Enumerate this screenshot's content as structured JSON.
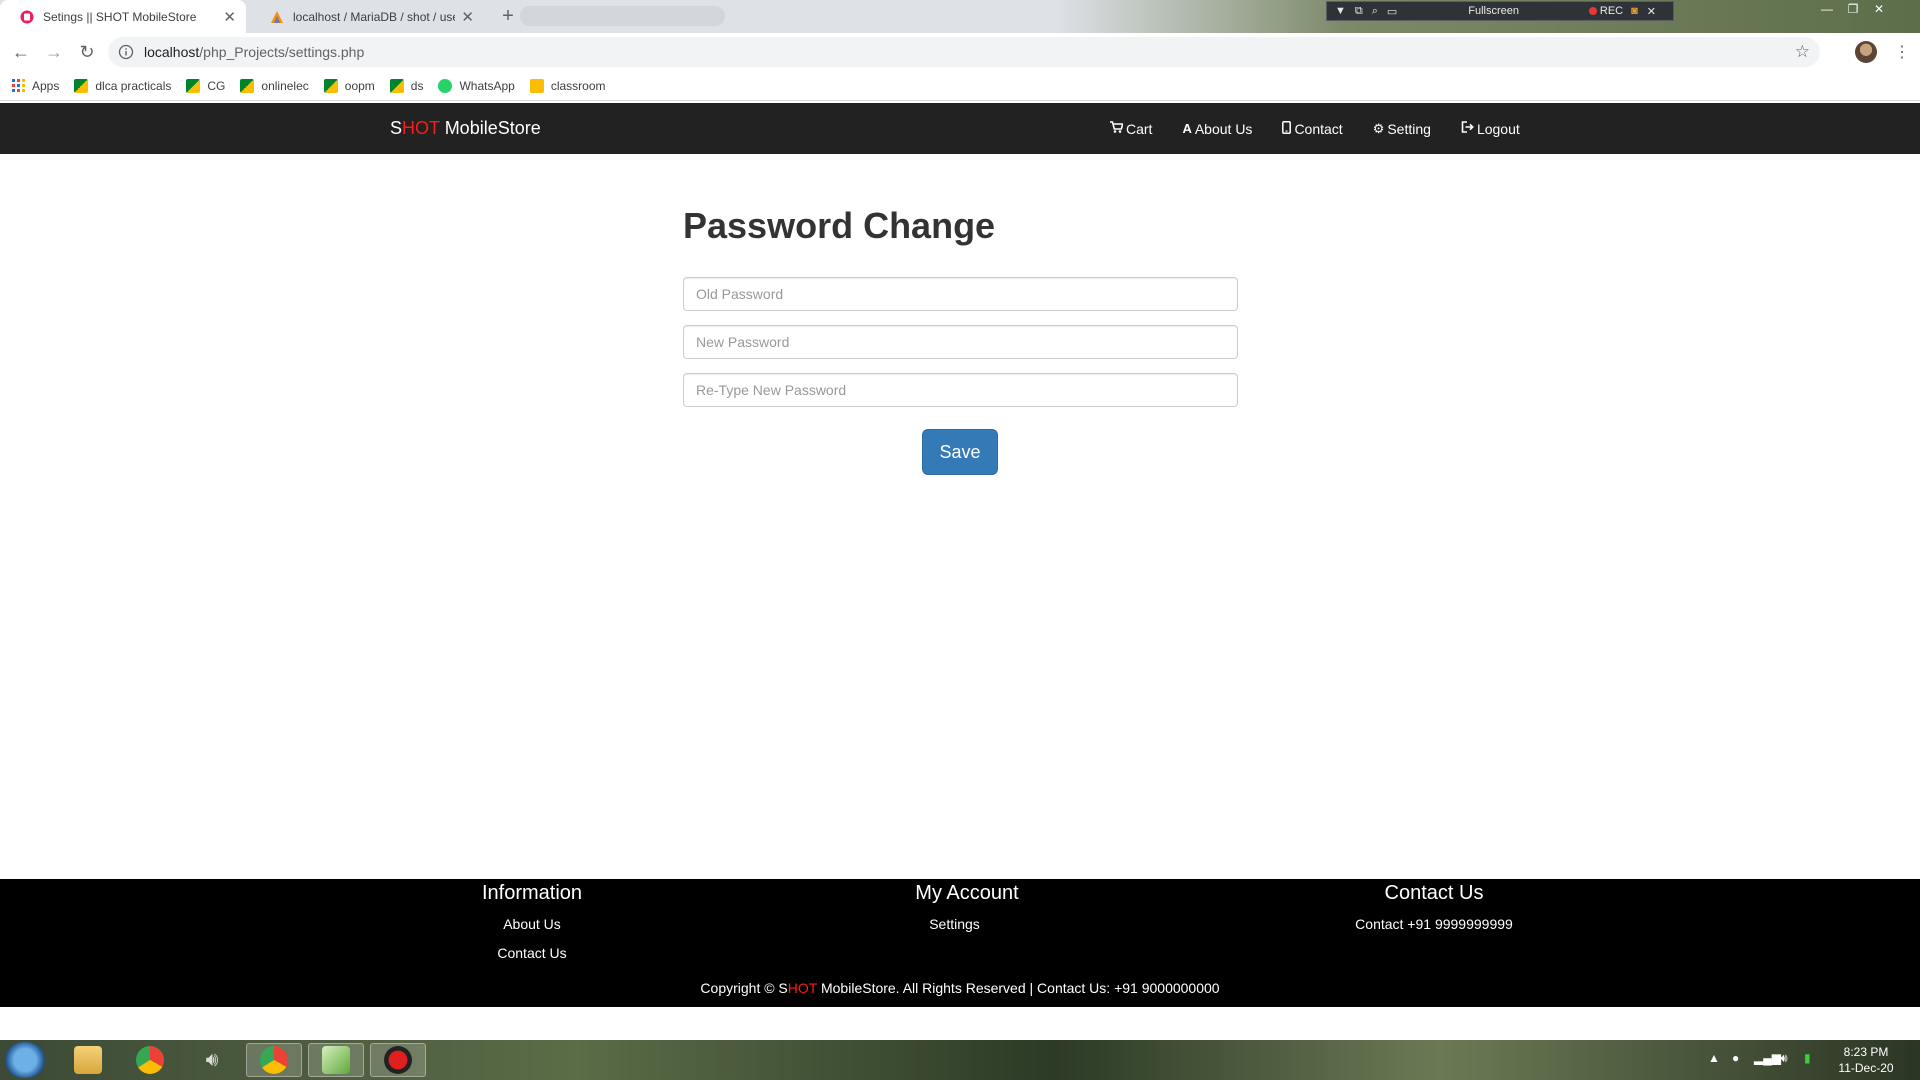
{
  "browser": {
    "tabs": [
      {
        "title": "Setings || SHOT MobileStore",
        "active": true
      },
      {
        "title": "localhost / MariaDB / shot / user",
        "active": false
      }
    ],
    "address": {
      "host": "localhost",
      "path": "/php_Projects/settings.php"
    },
    "bookmarks": [
      "Apps",
      "dlca practicals",
      "CG",
      "onlinelec",
      "oopm",
      "ds",
      "WhatsApp",
      "classroom"
    ],
    "recorder": {
      "mode": "Fullscreen",
      "rec_label": "REC"
    }
  },
  "site": {
    "brand": {
      "prefix": "S",
      "highlight": "HOT",
      "suffix": " MobileStore"
    },
    "nav": [
      {
        "label": "Cart",
        "icon": "cart-icon"
      },
      {
        "label": "About Us",
        "icon": "font-icon"
      },
      {
        "label": "Contact",
        "icon": "phone-icon"
      },
      {
        "label": "Setting",
        "icon": "gear-icon"
      },
      {
        "label": "Logout",
        "icon": "logout-icon"
      }
    ],
    "page_title": "Password Change",
    "form": {
      "old_placeholder": "Old Password",
      "new_placeholder": "New Password",
      "retype_placeholder": "Re-Type New Password",
      "save_label": "Save"
    },
    "footer": {
      "information": {
        "heading": "Information",
        "links": [
          "About Us",
          "Contact Us"
        ]
      },
      "my_account": {
        "heading": "My Account",
        "links": [
          "Settings"
        ]
      },
      "contact": {
        "heading": "Contact Us",
        "text": "Contact +91 9999999999"
      },
      "copyright_prefix": "Copyright © S",
      "copyright_highlight": "HOT",
      "copyright_suffix": " MobileStore. All Rights Reserved | Contact Us: +91 9000000000"
    },
    "colors": {
      "nav_bg": "#222222",
      "brand_red": "#ff1b1b",
      "button_blue": "#337ab7",
      "footer_bg": "#000000"
    }
  },
  "taskbar": {
    "time": "8:23 PM",
    "date": "11-Dec-20"
  }
}
